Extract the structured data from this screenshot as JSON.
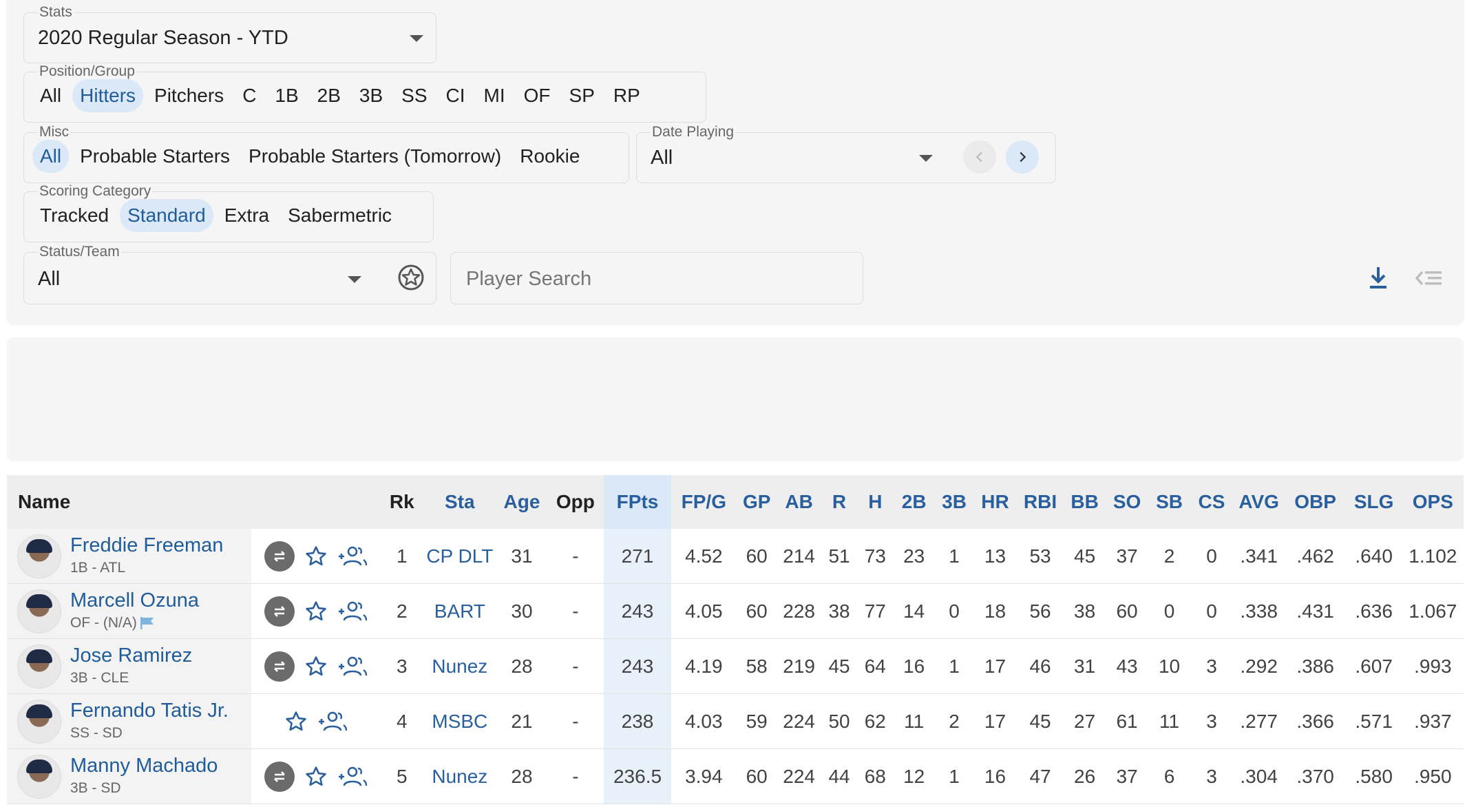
{
  "filters": {
    "stats": {
      "label": "Stats",
      "value": "2020 Regular Season - YTD"
    },
    "position_group": {
      "label": "Position/Group",
      "options": [
        "All",
        "Hitters",
        "Pitchers",
        "C",
        "1B",
        "2B",
        "3B",
        "SS",
        "CI",
        "MI",
        "OF",
        "SP",
        "RP"
      ],
      "selected": "Hitters"
    },
    "misc": {
      "label": "Misc",
      "options": [
        "All",
        "Probable Starters",
        "Probable Starters (Tomorrow)",
        "Rookie"
      ],
      "selected": "All"
    },
    "date_playing": {
      "label": "Date Playing",
      "value": "All"
    },
    "scoring_category": {
      "label": "Scoring Category",
      "options": [
        "Tracked",
        "Standard",
        "Extra",
        "Sabermetric"
      ],
      "selected": "Standard"
    },
    "status_team": {
      "label": "Status/Team",
      "value": "All"
    },
    "player_search": {
      "placeholder": "Player Search"
    }
  },
  "table": {
    "columns": [
      "Name",
      "Rk",
      "Sta",
      "Age",
      "Opp",
      "FPts",
      "FP/G",
      "GP",
      "AB",
      "R",
      "H",
      "2B",
      "3B",
      "HR",
      "RBI",
      "BB",
      "SO",
      "SB",
      "CS",
      "AVG",
      "OBP",
      "SLG",
      "OPS"
    ],
    "rows": [
      {
        "name": "Freddie Freeman",
        "info": "1B - ATL",
        "flag": false,
        "trade": true,
        "rk": "1",
        "sta": "CP DLT",
        "age": "31",
        "opp": "-",
        "fpts": "271",
        "fpg": "4.52",
        "gp": "60",
        "ab": "214",
        "r": "51",
        "h": "73",
        "d": "23",
        "t": "1",
        "hr": "13",
        "rbi": "53",
        "bb": "45",
        "so": "37",
        "sb": "2",
        "cs": "0",
        "avg": ".341",
        "obp": ".462",
        "slg": ".640",
        "ops": "1.102"
      },
      {
        "name": "Marcell Ozuna",
        "info": "OF - (N/A)",
        "flag": true,
        "trade": true,
        "rk": "2",
        "sta": "BART",
        "age": "30",
        "opp": "-",
        "fpts": "243",
        "fpg": "4.05",
        "gp": "60",
        "ab": "228",
        "r": "38",
        "h": "77",
        "d": "14",
        "t": "0",
        "hr": "18",
        "rbi": "56",
        "bb": "38",
        "so": "60",
        "sb": "0",
        "cs": "0",
        "avg": ".338",
        "obp": ".431",
        "slg": ".636",
        "ops": "1.067"
      },
      {
        "name": "Jose Ramirez",
        "info": "3B - CLE",
        "flag": false,
        "trade": true,
        "rk": "3",
        "sta": "Nunez",
        "age": "28",
        "opp": "-",
        "fpts": "243",
        "fpg": "4.19",
        "gp": "58",
        "ab": "219",
        "r": "45",
        "h": "64",
        "d": "16",
        "t": "1",
        "hr": "17",
        "rbi": "46",
        "bb": "31",
        "so": "43",
        "sb": "10",
        "cs": "3",
        "avg": ".292",
        "obp": ".386",
        "slg": ".607",
        "ops": ".993"
      },
      {
        "name": "Fernando Tatis Jr.",
        "info": "SS - SD",
        "flag": false,
        "trade": false,
        "rk": "4",
        "sta": "MSBC",
        "age": "21",
        "opp": "-",
        "fpts": "238",
        "fpg": "4.03",
        "gp": "59",
        "ab": "224",
        "r": "50",
        "h": "62",
        "d": "11",
        "t": "2",
        "hr": "17",
        "rbi": "45",
        "bb": "27",
        "so": "61",
        "sb": "11",
        "cs": "3",
        "avg": ".277",
        "obp": ".366",
        "slg": ".571",
        "ops": ".937"
      },
      {
        "name": "Manny Machado",
        "info": "3B - SD",
        "flag": false,
        "trade": true,
        "rk": "5",
        "sta": "Nunez",
        "age": "28",
        "opp": "-",
        "fpts": "236.5",
        "fpg": "3.94",
        "gp": "60",
        "ab": "224",
        "r": "44",
        "h": "68",
        "d": "12",
        "t": "1",
        "hr": "16",
        "rbi": "47",
        "bb": "26",
        "so": "37",
        "sb": "6",
        "cs": "3",
        "avg": ".304",
        "obp": ".370",
        "slg": ".580",
        "ops": ".950"
      }
    ]
  },
  "colors": {
    "accent": "#2a5f9e",
    "chip_active_bg": "#dbe8f7",
    "panel_bg": "#f5f5f5"
  },
  "icons": [
    "chevron-down-icon",
    "chevron-left-icon",
    "chevron-right-icon",
    "sheriff-star-icon",
    "download-icon",
    "column-settings-icon",
    "trade-icon",
    "star-icon",
    "add-player-icon",
    "flag-icon"
  ]
}
